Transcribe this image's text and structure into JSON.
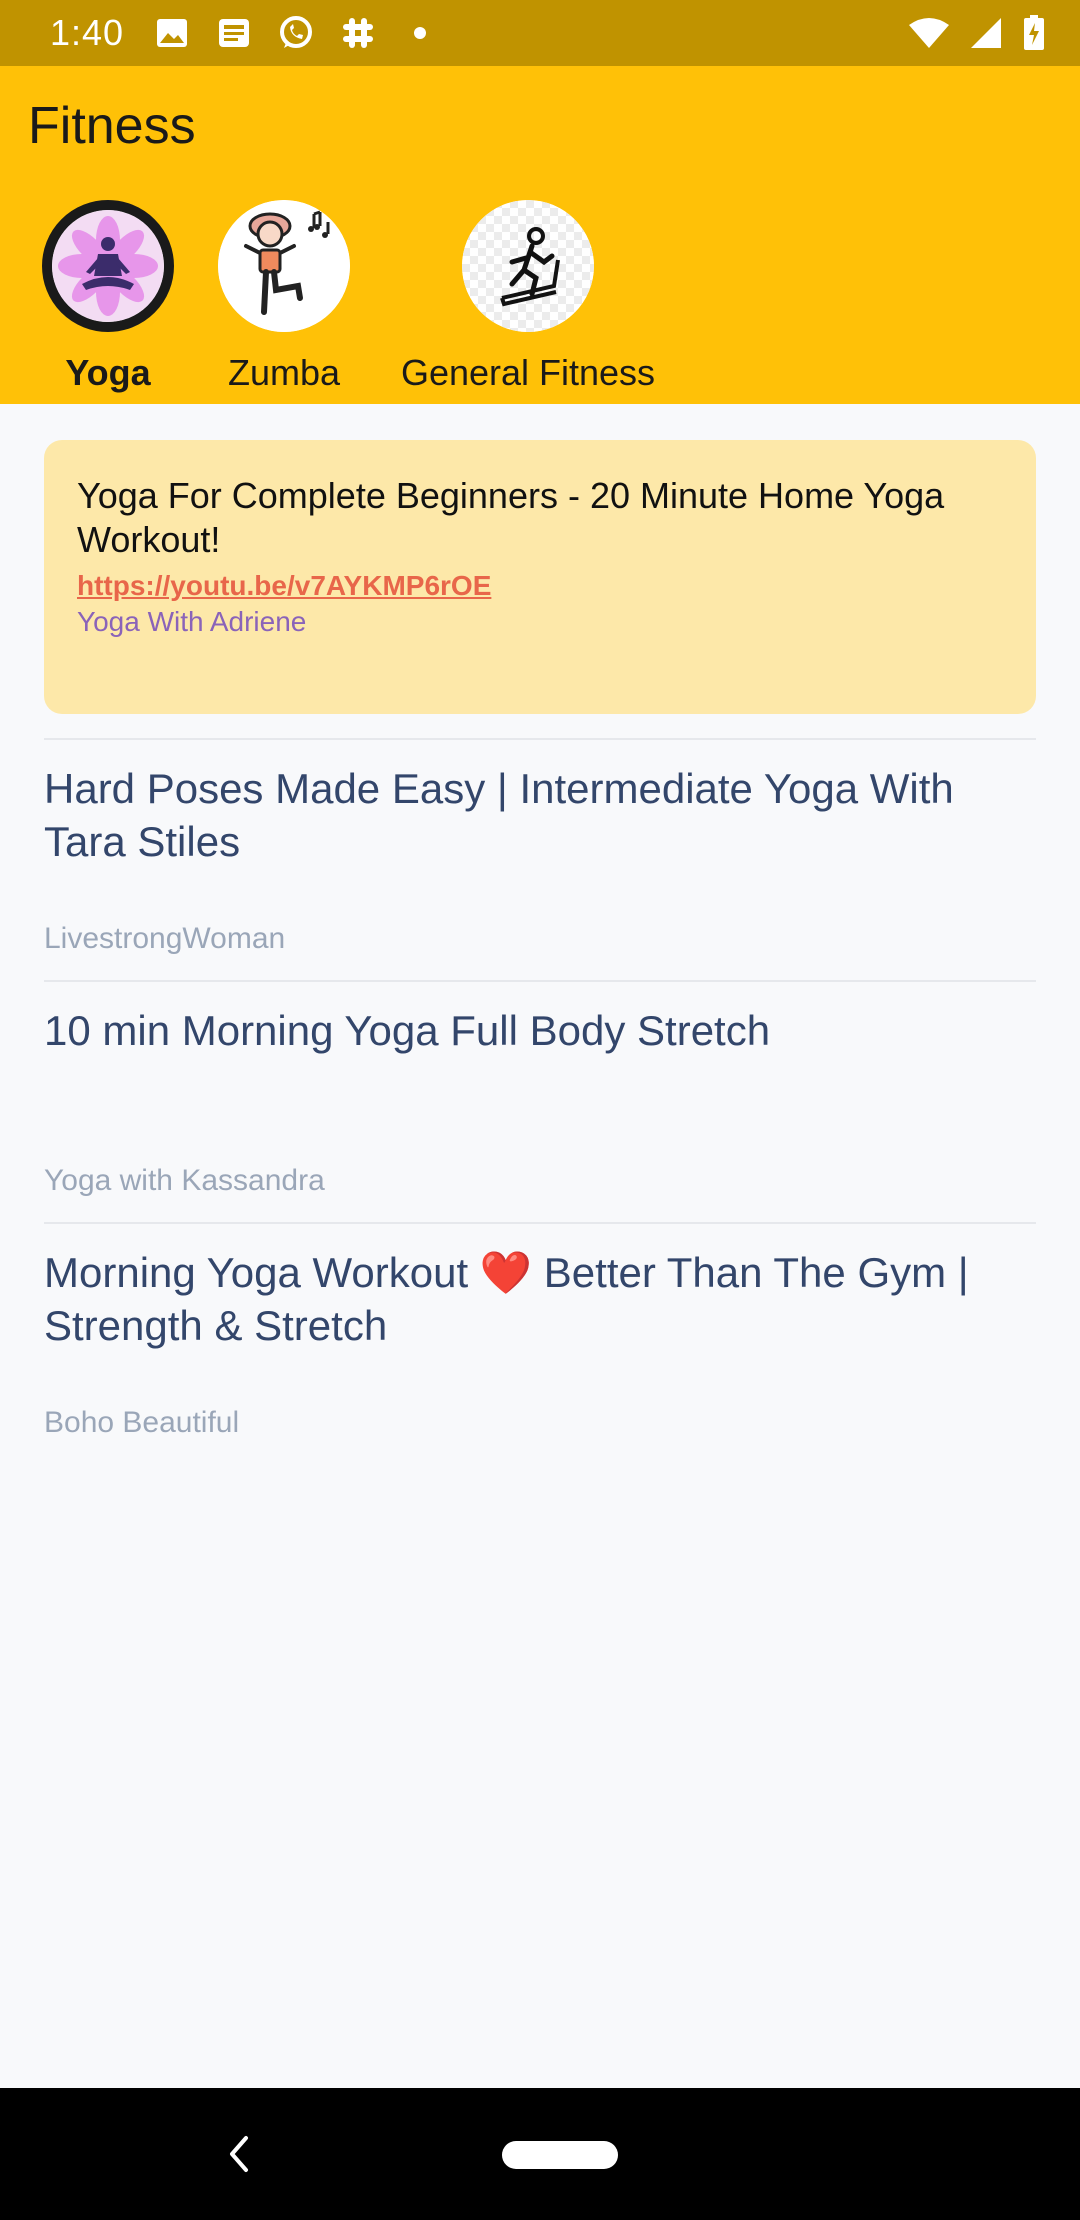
{
  "status_bar": {
    "time": "1:40",
    "icons": [
      "image-icon",
      "news-icon",
      "whatsapp-icon",
      "slack-icon",
      "dot-icon"
    ],
    "right_icons": [
      "wifi-icon",
      "signal-icon",
      "battery-charging-icon"
    ]
  },
  "app": {
    "title": "Fitness",
    "accent_color": "#ffc107",
    "status_color": "#c09300"
  },
  "categories": [
    {
      "label": "Yoga",
      "icon": "yoga-meditation-icon",
      "selected": true
    },
    {
      "label": "Zumba",
      "icon": "zumba-dancer-icon",
      "selected": false
    },
    {
      "label": "General Fitness",
      "icon": "running-treadmill-icon",
      "selected": false
    }
  ],
  "featured": {
    "title": "Yoga For Complete Beginners - 20 Minute Home Yoga Workout!",
    "link": "https://youtu.be/v7AYKMP6rOE",
    "author": "Yoga With Adriene",
    "background": "#fde8a9"
  },
  "videos": [
    {
      "title": "Hard Poses Made Easy | Intermediate Yoga With Tara Stiles",
      "author": "LivestrongWoman"
    },
    {
      "title": "10 min Morning Yoga Full Body Stretch",
      "author": "Yoga with Kassandra"
    },
    {
      "title": "Morning Yoga Workout ❤️ Better Than The Gym | Strength & Stretch",
      "author": "Boho Beautiful"
    }
  ],
  "nav": {
    "back_icon": "back-chevron-icon",
    "home_icon": "home-pill-icon"
  }
}
